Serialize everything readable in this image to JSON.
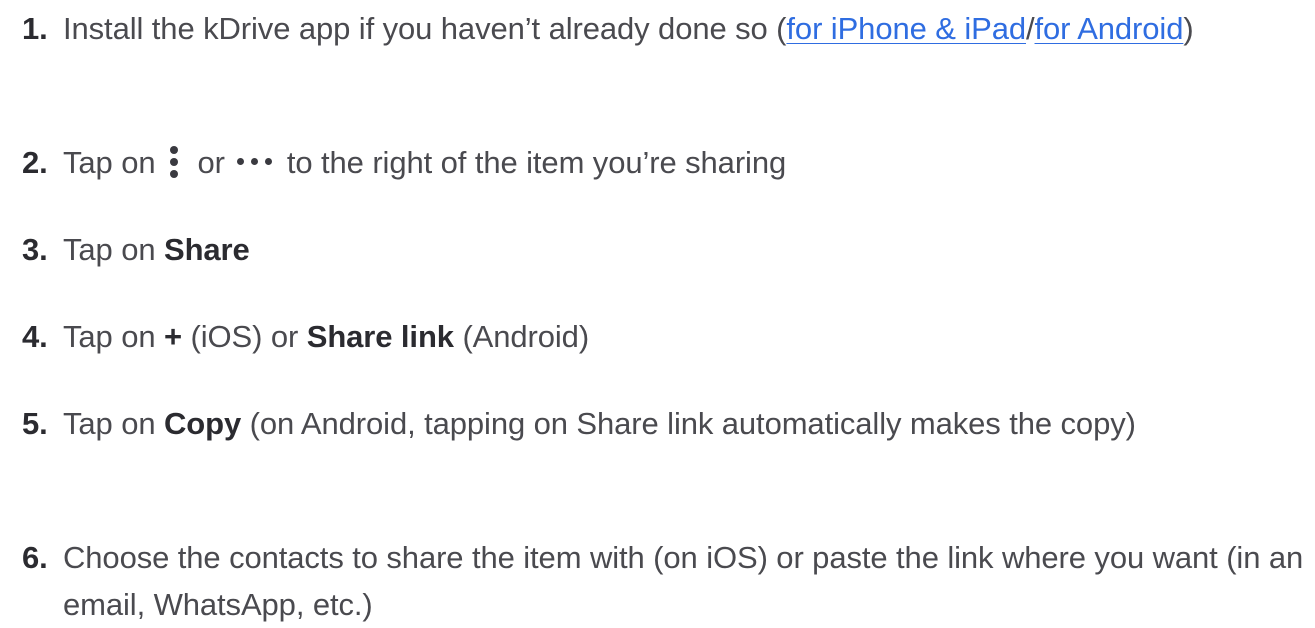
{
  "steps": [
    {
      "number": "1.",
      "text_before": "Install the kDrive app if you haven’t already done so (",
      "link_ios": "for iPhone & iPad",
      "separator": "/",
      "link_android": "for Android",
      "text_after": ")"
    },
    {
      "number": "2.",
      "text_before": "Tap on",
      "icon_vertical": "more-vertical-icon",
      "or": "or",
      "icon_horizontal": "more-horizontal-icon",
      "text_after": "to the right of the item you’re sharing"
    },
    {
      "number": "3.",
      "text_before": "Tap on ",
      "bold": "Share"
    },
    {
      "number": "4.",
      "text_before": "Tap on ",
      "bold_plus": "+",
      "text_middle": " (iOS) or ",
      "bold": "Share link",
      "text_after": " (Android)"
    },
    {
      "number": "5.",
      "text_before": "Tap on ",
      "bold": "Copy",
      "text_after": " (on Android, tapping on Share link automatically makes the copy)"
    },
    {
      "number": "6.",
      "text": "Choose the contacts to share the item with (on iOS) or paste the link where you want (in an email, WhatsApp, etc.)"
    }
  ],
  "colors": {
    "text": "#4a4a4f",
    "bold": "#2b2b30",
    "link": "#2f6de1"
  }
}
